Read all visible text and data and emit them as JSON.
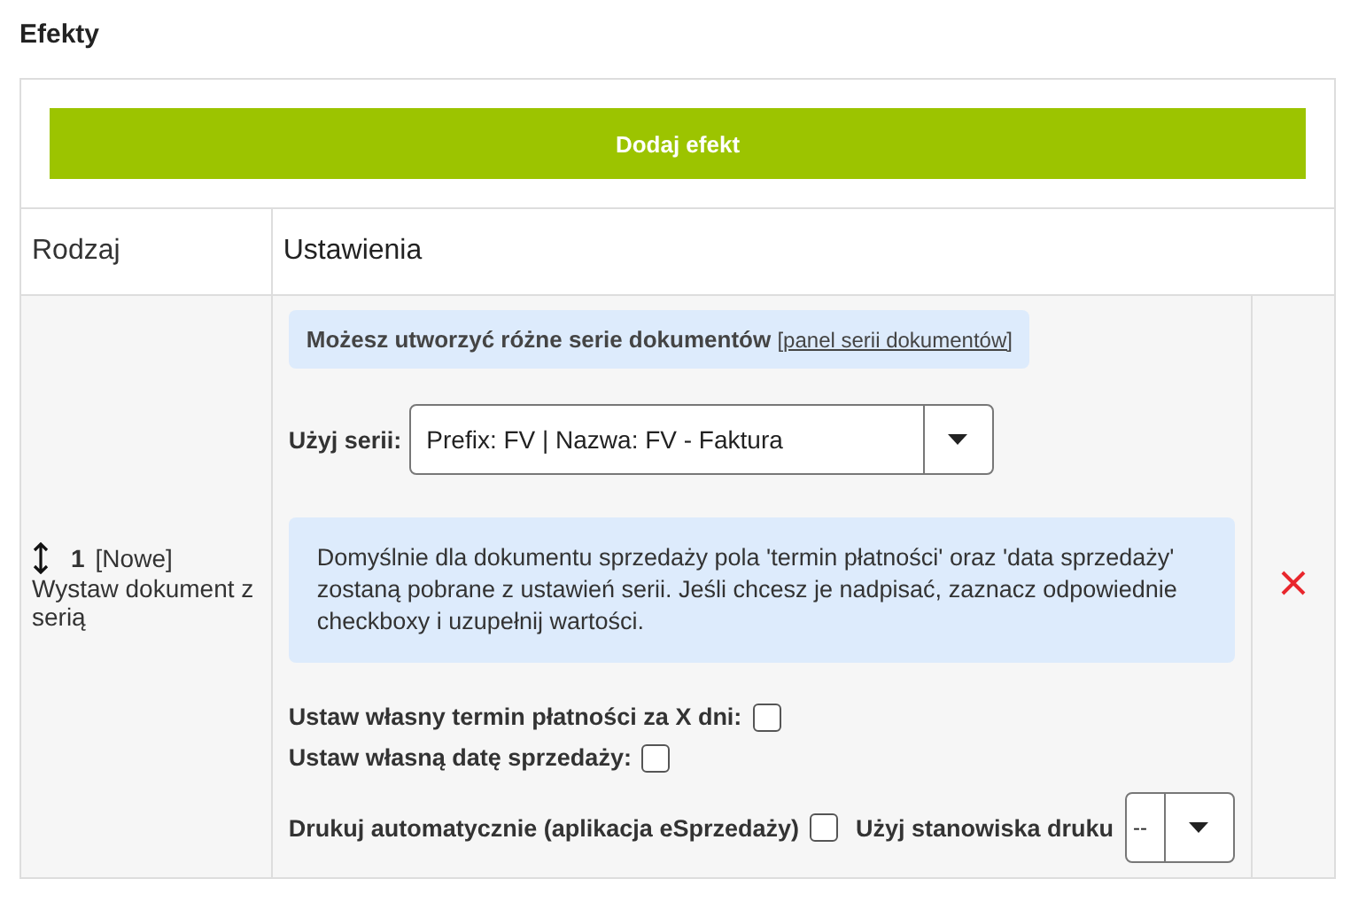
{
  "title": "Efekty",
  "add_button": "Dodaj efekt",
  "columns": [
    "Rodzaj",
    "Ustawienia"
  ],
  "effects": [
    {
      "number": "1",
      "badge": "[Nowe]",
      "name": "Wystaw dokument z serią",
      "series_hint": {
        "text": "Możesz utworzyć różne serie dokumentów",
        "link": "[panel serii dokumentów]"
      },
      "series_label": "Użyj serii:",
      "series_value": "Prefix: FV | Nazwa: FV - Faktura",
      "info": "Domyślnie dla dokumentu sprzedaży pola 'termin płatności' oraz 'data sprzedaży' zostaną pobrane z ustawień serii. Jeśli chcesz je nadpisać, zaznacz odpowiednie checkboxy i uzupełnij wartości.",
      "options": [
        {
          "label": "Ustaw własny termin płatności za X dni:",
          "checked": false
        },
        {
          "label": "Ustaw własną datę sprzedaży:",
          "checked": false
        }
      ],
      "print_option": {
        "label": "Drukuj automatycznie (aplikacja eSprzedaży)",
        "checked": false
      },
      "printer": {
        "label": "Użyj stanowiska druku",
        "value": "--"
      }
    }
  ]
}
